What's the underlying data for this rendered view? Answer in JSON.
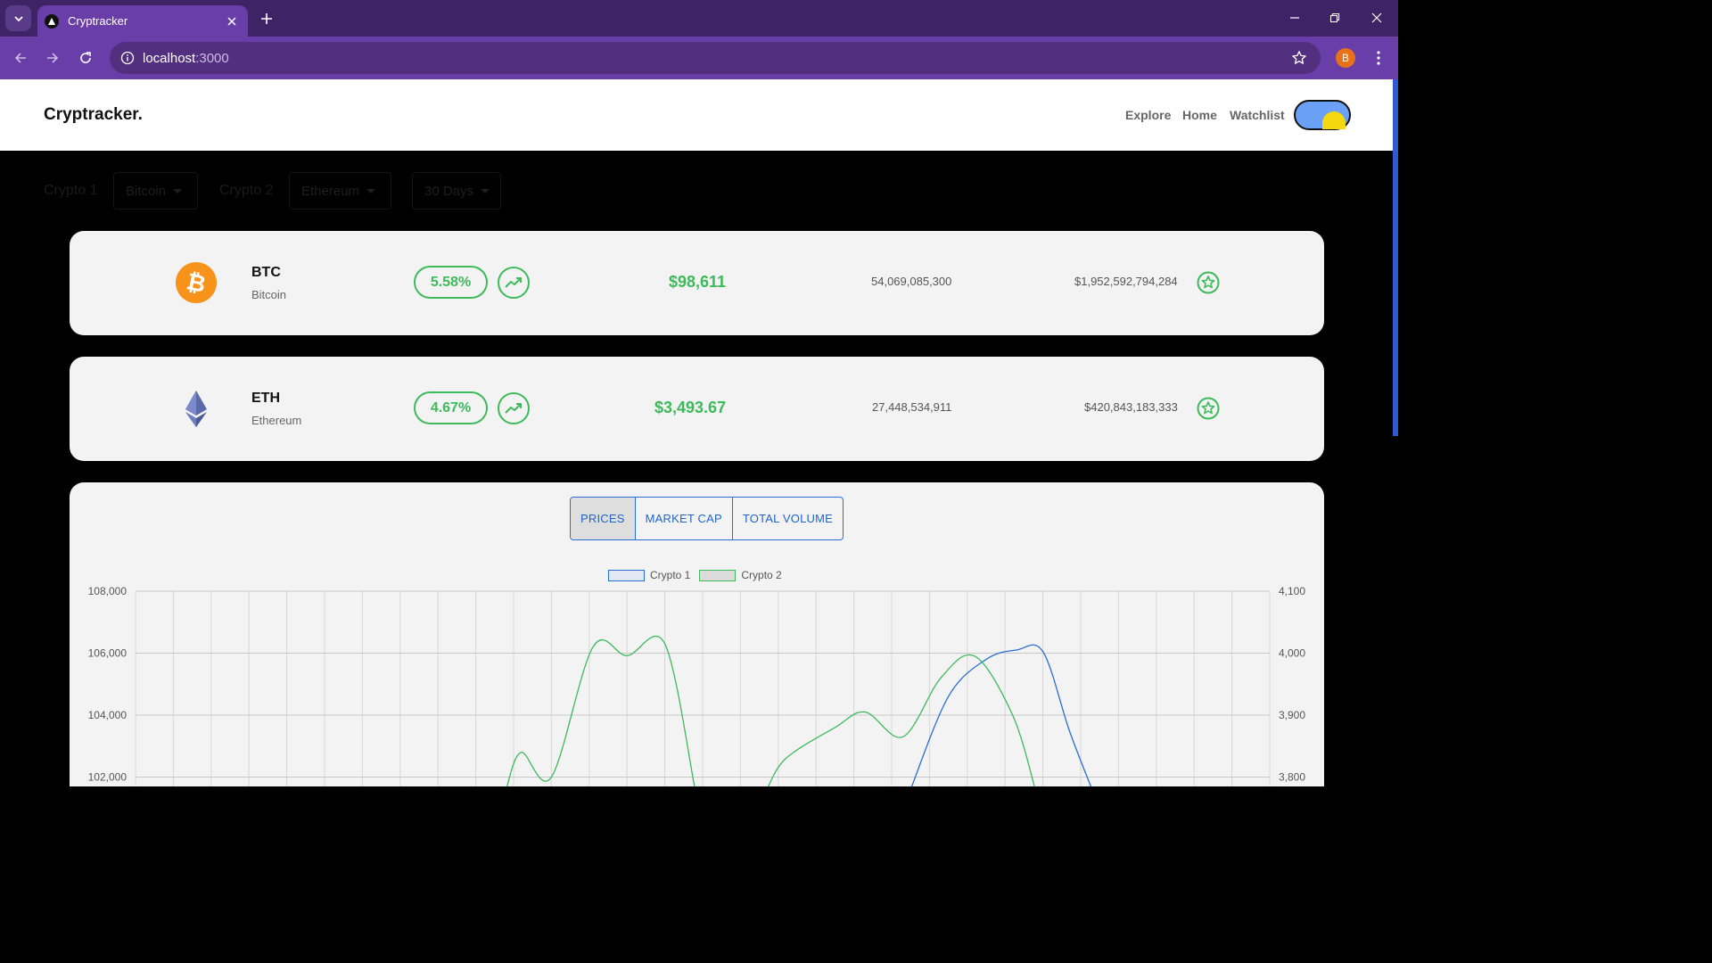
{
  "browser": {
    "tab_title": "Cryptracker",
    "url_host": "localhost",
    "url_port": ":3000",
    "profile_initial": "B",
    "accent": "#6a3ea8"
  },
  "header": {
    "logo": "Cryptracker.",
    "nav": {
      "explore": "Explore",
      "home": "Home",
      "watchlist": "Watchlist"
    }
  },
  "controls": {
    "crypto1_label": "Crypto 1",
    "crypto1_value": "Bitcoin",
    "crypto2_label": "Crypto 2",
    "crypto2_value": "Ethereum",
    "days_value": "30 Days"
  },
  "coins": [
    {
      "symbol": "BTC",
      "name": "Bitcoin",
      "change": "5.58%",
      "price": "$98,611",
      "volume": "54,069,085,300",
      "market_cap": "$1,952,592,794,284",
      "icon": "bitcoin-logo-icon"
    },
    {
      "symbol": "ETH",
      "name": "Ethereum",
      "change": "4.67%",
      "price": "$3,493.67",
      "volume": "27,448,534,911",
      "market_cap": "$420,843,183,333",
      "icon": "ethereum-logo-icon"
    }
  ],
  "chart_toggle": {
    "prices": "PRICES",
    "market_cap": "MARKET CAP",
    "total_volume": "TOTAL VOLUME"
  },
  "chart_data": {
    "type": "line",
    "legend": [
      "Crypto 1",
      "Crypto 2"
    ],
    "y_left_ticks": [
      "108,000",
      "106,000",
      "104,000",
      "102,000"
    ],
    "y_right_ticks": [
      "4,100",
      "4,000",
      "3,900",
      "3,800"
    ],
    "y_left_range": [
      102000,
      108000
    ],
    "y_right_range": [
      3800,
      4100
    ],
    "x_range": [
      0,
      30
    ],
    "grid": true,
    "series": [
      {
        "name": "Crypto 1",
        "color": "#2a6ed3",
        "axis": "left",
        "points": [
          [
            20.5,
            101600
          ],
          [
            21.5,
            104600
          ],
          [
            22.5,
            105800
          ],
          [
            23.3,
            106100
          ],
          [
            24,
            106050
          ],
          [
            24.7,
            103500
          ],
          [
            25.3,
            101600
          ]
        ]
      },
      {
        "name": "Crypto 2",
        "color": "#3dba5a",
        "axis": "right",
        "points": [
          [
            9.8,
            3780
          ],
          [
            10.2,
            3840
          ],
          [
            11,
            3800
          ],
          [
            12.1,
            4010
          ],
          [
            13,
            3996
          ],
          [
            14,
            4015
          ],
          [
            14.8,
            3780
          ]
        ]
      },
      {
        "name": "Crypto 2",
        "color": "#3dba5a",
        "axis": "right",
        "points": [
          [
            16.7,
            3780
          ],
          [
            17.2,
            3830
          ],
          [
            18.5,
            3880
          ],
          [
            19.3,
            3905
          ],
          [
            20.3,
            3865
          ],
          [
            21.3,
            3960
          ],
          [
            22.2,
            3995
          ],
          [
            23.2,
            3900
          ],
          [
            23.8,
            3780
          ]
        ]
      }
    ]
  }
}
